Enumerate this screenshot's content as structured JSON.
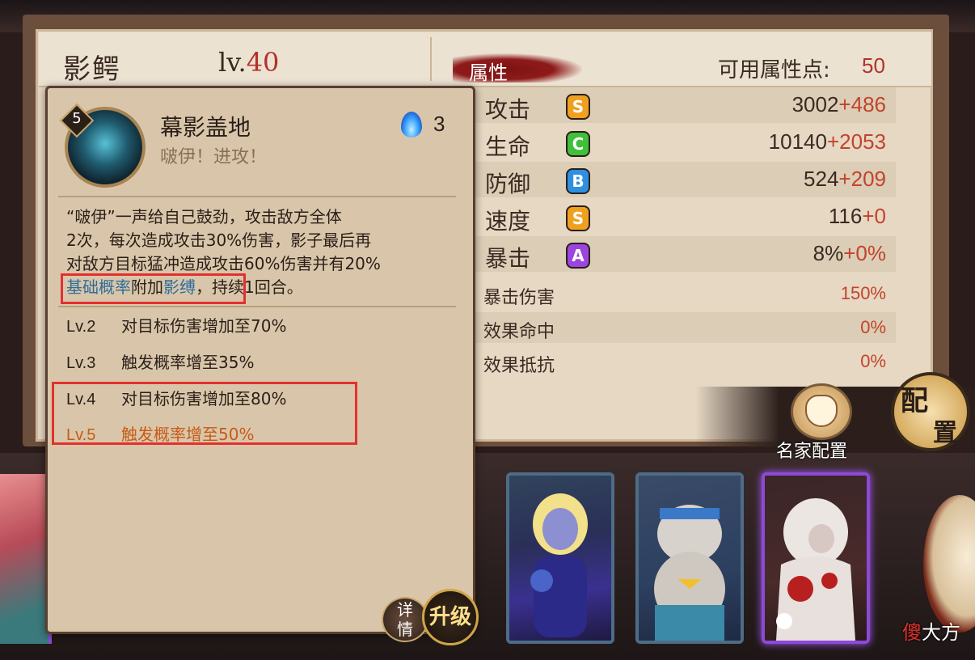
{
  "character": {
    "name": "影鳄",
    "level_prefix": "lv.",
    "level": "40"
  },
  "attributes": {
    "title": "属性",
    "points_label": "可用属性点:",
    "points_value": "50",
    "main_stats": [
      {
        "name": "攻击",
        "grade": "S",
        "base": "3002",
        "bonus": "+486",
        "color": "#f0a020"
      },
      {
        "name": "生命",
        "grade": "C",
        "base": "10140",
        "bonus": "+2053",
        "color": "#3fbf3a"
      },
      {
        "name": "防御",
        "grade": "B",
        "base": "524",
        "bonus": "+209",
        "color": "#2f8fe0"
      },
      {
        "name": "速度",
        "grade": "S",
        "base": "116",
        "bonus": "+0",
        "color": "#f0a020"
      },
      {
        "name": "暴击",
        "grade": "A",
        "base": "8%",
        "bonus": "+0%",
        "color": "#9c44e0"
      }
    ],
    "sub_stats": [
      {
        "name": "暴击伤害",
        "value": "150%"
      },
      {
        "name": "效果命中",
        "value": "0%"
      },
      {
        "name": "效果抵抗",
        "value": "0%"
      }
    ]
  },
  "skill": {
    "level_badge": "5",
    "name": "幕影盖地",
    "quote": "啵伊！进攻！",
    "cost": "3",
    "desc_line1": "“啵伊”一声给自己鼓劲，攻击敌方全体",
    "desc_line2": "2次，每次造成攻击30%伤害，影子最后再",
    "desc_line3": "对敌方目标猛冲造成攻击60%伤害并有20%",
    "desc_kw1": "基础概率",
    "desc_mid": "附加",
    "desc_kw2": "影缚",
    "desc_end": "，持续1回合。",
    "upgrades": [
      {
        "lv": "Lv.2",
        "text": "对目标伤害增加至70%"
      },
      {
        "lv": "Lv.3",
        "text": "触发概率增至35%"
      },
      {
        "lv": "Lv.4",
        "text": "对目标伤害增加至80%"
      },
      {
        "lv": "Lv.5",
        "text": "触发概率增至50%"
      }
    ]
  },
  "buttons": {
    "detail": "详情",
    "upgrade": "升级",
    "config_label": "名家配置",
    "config_big_1": "配",
    "config_big_2": "置"
  },
  "watermark": {
    "red": "傻",
    "white": "大方"
  }
}
